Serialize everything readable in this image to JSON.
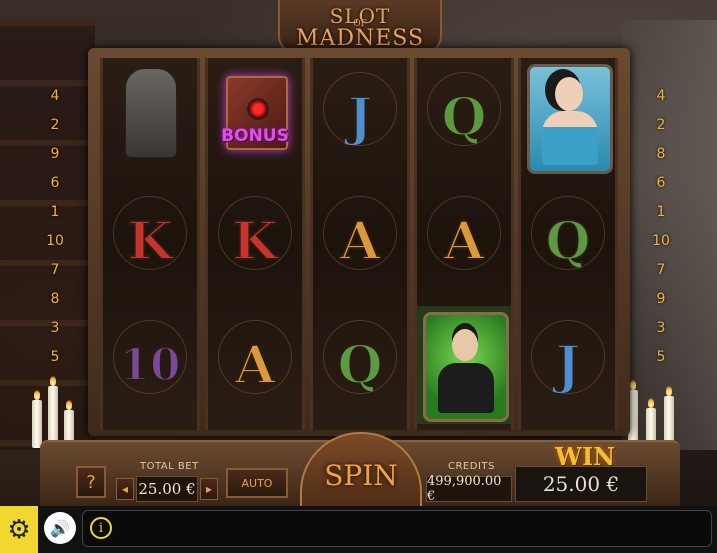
{
  "title": {
    "line1": "SLOT",
    "line2": "OF",
    "line3": "MADNESS"
  },
  "paylines_left": [
    "4",
    "2",
    "9",
    "6",
    "1",
    "10",
    "7",
    "8",
    "3",
    "5"
  ],
  "paylines_right": [
    "4",
    "2",
    "8",
    "6",
    "1",
    "10",
    "7",
    "9",
    "3",
    "5"
  ],
  "reels": [
    [
      {
        "kind": "statue",
        "name": "gargoyle-statue-symbol"
      },
      {
        "kind": "letter",
        "text": "K",
        "cls": "sym-K"
      },
      {
        "kind": "letter",
        "text": "10",
        "cls": "sym-10"
      }
    ],
    [
      {
        "kind": "bonus",
        "text": "BONUS"
      },
      {
        "kind": "letter",
        "text": "K",
        "cls": "sym-K"
      },
      {
        "kind": "letter",
        "text": "A",
        "cls": "sym-A"
      }
    ],
    [
      {
        "kind": "letter",
        "text": "J",
        "cls": "sym-J"
      },
      {
        "kind": "letter",
        "text": "A",
        "cls": "sym-A"
      },
      {
        "kind": "letter",
        "text": "Q",
        "cls": "sym-Q"
      }
    ],
    [
      {
        "kind": "letter",
        "text": "Q",
        "cls": "sym-Q"
      },
      {
        "kind": "letter",
        "text": "A",
        "cls": "sym-A"
      },
      {
        "kind": "man",
        "name": "gentleman-symbol"
      }
    ],
    [
      {
        "kind": "lady",
        "name": "lady-symbol"
      },
      {
        "kind": "letter",
        "text": "Q",
        "cls": "sym-Q"
      },
      {
        "kind": "letter",
        "text": "J",
        "cls": "sym-J"
      }
    ]
  ],
  "console": {
    "help_label": "?",
    "total_bet_label": "TOTAL BET",
    "total_bet_value": "25.00 €",
    "decrease": "◂",
    "increase": "▸",
    "auto_label": "AUTO",
    "spin_label": "SPIN",
    "credits_label": "CREDITS",
    "credits_value": "499,900.00 €",
    "win_label": "WIN",
    "win_value": "25.00 €"
  },
  "toolbar": {
    "gear_icon": "⚙",
    "sound_icon": "🔊",
    "info_icon": "i"
  },
  "colors": {
    "accent": "#f0a040",
    "toolbar_yellow": "#f0d830",
    "bonus_purple": "#e050e8"
  }
}
